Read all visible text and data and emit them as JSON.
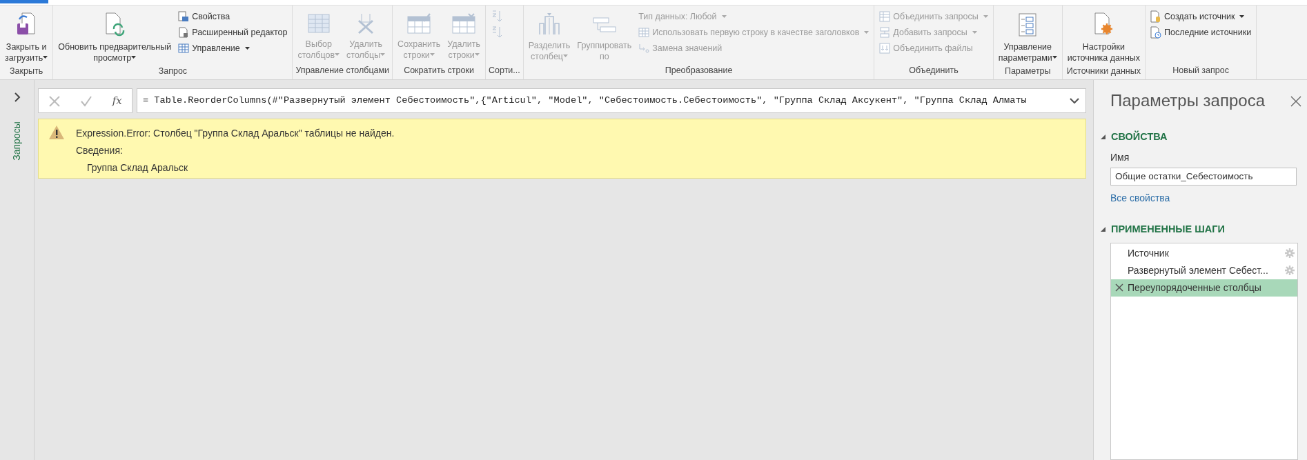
{
  "ribbon": {
    "groups": [
      {
        "label": "Закрыть",
        "items": [
          {
            "kind": "large",
            "lines": [
              "Закрыть и",
              "загрузить"
            ],
            "dropdown": true,
            "disabled": false
          }
        ]
      },
      {
        "label": "Запрос",
        "items": [
          {
            "kind": "large",
            "lines": [
              "Обновить предварительный",
              "просмотр"
            ],
            "dropdown": true,
            "disabled": false
          },
          {
            "kind": "stack",
            "items": [
              {
                "label": "Свойства",
                "dropdown": false,
                "disabled": false
              },
              {
                "label": "Расширенный редактор",
                "dropdown": false,
                "disabled": false
              },
              {
                "label": "Управление",
                "dropdown": true,
                "disabled": false
              }
            ]
          }
        ]
      },
      {
        "label": "Управление столбцами",
        "items": [
          {
            "kind": "large",
            "lines": [
              "Выбор",
              "столбцов"
            ],
            "dropdown": true,
            "disabled": true
          },
          {
            "kind": "large",
            "lines": [
              "Удалить",
              "столбцы"
            ],
            "dropdown": true,
            "disabled": true
          }
        ]
      },
      {
        "label": "Сократить строки",
        "items": [
          {
            "kind": "large",
            "lines": [
              "Сохранить",
              "строки"
            ],
            "dropdown": true,
            "disabled": true
          },
          {
            "kind": "large",
            "lines": [
              "Удалить",
              "строки"
            ],
            "dropdown": true,
            "disabled": true
          }
        ]
      },
      {
        "label": "Сорти...",
        "items": [
          {
            "kind": "stack",
            "items": [
              {
                "dropdown": false,
                "disabled": true
              },
              {
                "dropdown": false,
                "disabled": true
              }
            ]
          }
        ]
      },
      {
        "label": "Преобразование",
        "items": [
          {
            "kind": "large",
            "lines": [
              "Разделить",
              "столбец"
            ],
            "dropdown": true,
            "disabled": true
          },
          {
            "kind": "large",
            "lines": [
              "Группировать",
              "по"
            ],
            "dropdown": false,
            "disabled": true
          },
          {
            "kind": "stack",
            "items": [
              {
                "label": "Тип данных: Любой",
                "dropdown": true,
                "disabled": true
              },
              {
                "label": "Использовать первую строку в качестве заголовков",
                "dropdown": true,
                "disabled": true
              },
              {
                "label": "Замена значений",
                "dropdown": false,
                "disabled": true
              }
            ]
          }
        ]
      },
      {
        "label": "Объединить",
        "items": [
          {
            "kind": "stack",
            "items": [
              {
                "label": "Объединить запросы",
                "dropdown": true,
                "disabled": true
              },
              {
                "label": "Добавить запросы",
                "dropdown": true,
                "disabled": true
              },
              {
                "label": "Объединить файлы",
                "dropdown": false,
                "disabled": true
              }
            ]
          }
        ]
      },
      {
        "label": "Параметры",
        "items": [
          {
            "kind": "large",
            "lines": [
              "Управление",
              "параметрами"
            ],
            "dropdown": true,
            "disabled": false
          }
        ]
      },
      {
        "label": "Источники данных",
        "items": [
          {
            "kind": "large",
            "lines": [
              "Настройки",
              "источника данных"
            ],
            "dropdown": false,
            "disabled": false
          }
        ]
      },
      {
        "label": "Новый запрос",
        "items": [
          {
            "kind": "stack",
            "items": [
              {
                "label": "Создать источник",
                "dropdown": true,
                "disabled": false
              },
              {
                "label": "Последние источники",
                "dropdown": false,
                "disabled": false
              }
            ]
          }
        ]
      }
    ]
  },
  "queries_pane": {
    "label": "Запросы"
  },
  "formula_bar": {
    "fx": "fx",
    "formula": "= Table.ReorderColumns(#\"Развернутый элемент Себестоимость\",{\"Articul\", \"Model\", \"Себестоимость.Себестоимость\", \"Группа Склад Аксукент\", \"Группа Склад Алматы"
  },
  "error": {
    "message": "Expression.Error: Столбец \"Группа Склад Аральск\" таблицы не найден.",
    "details_label": "Сведения:",
    "detail": "Группа Склад Аральск"
  },
  "query_settings": {
    "title": "Параметры запроса",
    "properties": {
      "heading": "СВОЙСТВА",
      "expanded": true,
      "name_label": "Имя",
      "name_value": "Общие остатки_Себестоимость",
      "all_properties_link": "Все свойства"
    },
    "applied_steps": {
      "heading": "ПРИМЕНЕННЫЕ ШАГИ",
      "expanded": true,
      "steps": [
        {
          "label": "Источник",
          "settings": true,
          "error": false,
          "selected": false
        },
        {
          "label": "Развернутый элемент Себест...",
          "settings": true,
          "error": false,
          "selected": false
        },
        {
          "label": "Переупорядоченные столбцы",
          "settings": false,
          "error": true,
          "selected": true
        }
      ]
    }
  }
}
